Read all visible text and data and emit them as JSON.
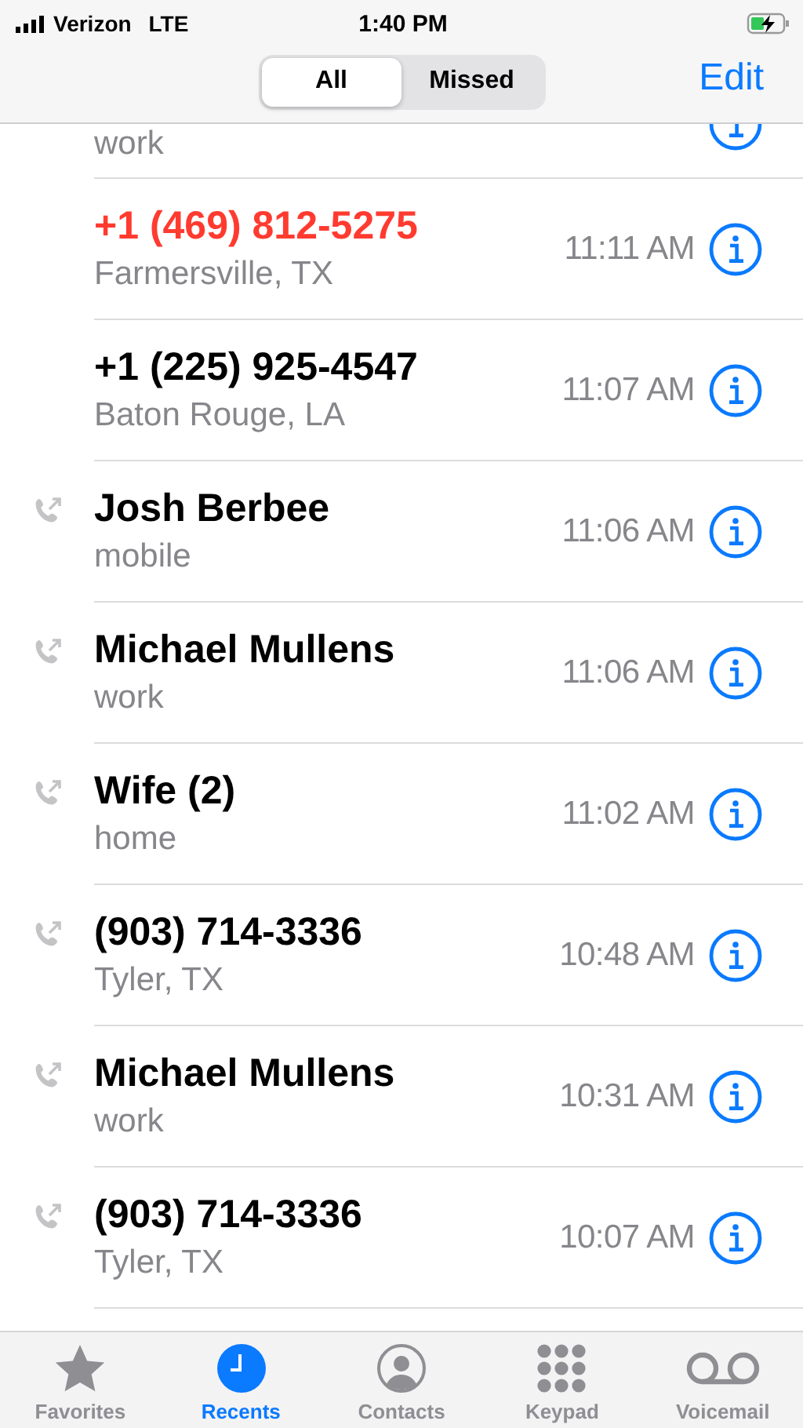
{
  "status_bar": {
    "carrier": "Verizon",
    "network": "LTE",
    "time": "1:40 PM"
  },
  "header": {
    "segments": [
      {
        "label": "All",
        "selected": true
      },
      {
        "label": "Missed",
        "selected": false
      }
    ],
    "edit": "Edit"
  },
  "calls": [
    {
      "subtitle": "work"
    },
    {
      "name": "+1 (469) 812-5275",
      "subtitle": "Farmersville, TX",
      "time": "11:11 AM",
      "outgoing": false,
      "missed": true
    },
    {
      "name": "+1 (225) 925-4547",
      "subtitle": "Baton Rouge, LA",
      "time": "11:07 AM",
      "outgoing": false,
      "missed": false
    },
    {
      "name": "Josh Berbee",
      "subtitle": "mobile",
      "time": "11:06 AM",
      "outgoing": true,
      "missed": false
    },
    {
      "name": "Michael Mullens",
      "subtitle": "work",
      "time": "11:06 AM",
      "outgoing": true,
      "missed": false
    },
    {
      "name": "Wife (2)",
      "subtitle": "home",
      "time": "11:02 AM",
      "outgoing": true,
      "missed": false
    },
    {
      "name": "(903) 714-3336",
      "subtitle": "Tyler, TX",
      "time": "10:48 AM",
      "outgoing": true,
      "missed": false
    },
    {
      "name": "Michael Mullens",
      "subtitle": "work",
      "time": "10:31 AM",
      "outgoing": true,
      "missed": false
    },
    {
      "name": "(903) 714-3336",
      "subtitle": "Tyler, TX",
      "time": "10:07 AM",
      "outgoing": true,
      "missed": false
    }
  ],
  "tabs": [
    {
      "kind": "favorites",
      "label": "Favorites",
      "selected": false
    },
    {
      "kind": "recents",
      "label": "Recents",
      "selected": true
    },
    {
      "kind": "contacts",
      "label": "Contacts",
      "selected": false
    },
    {
      "kind": "keypad",
      "label": "Keypad",
      "selected": false
    },
    {
      "kind": "voicemail",
      "label": "Voicemail",
      "selected": false
    }
  ]
}
